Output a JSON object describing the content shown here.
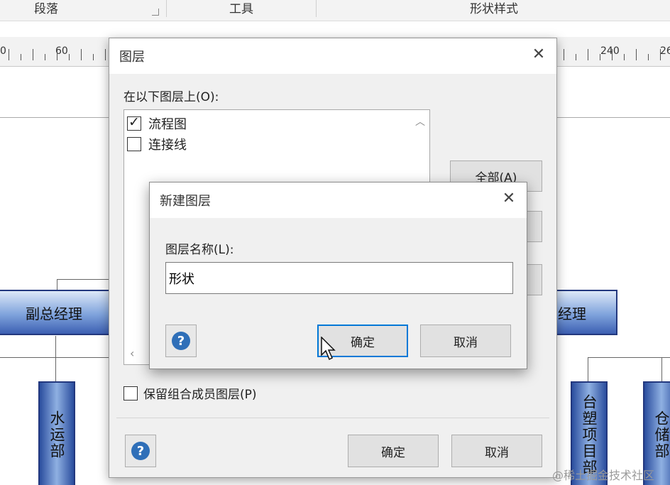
{
  "ribbon": {
    "paragraph": "段落",
    "tools": "工具",
    "shape_style": "形状样式"
  },
  "ruler": {
    "labels": [
      "0",
      "60",
      "240",
      "26"
    ]
  },
  "canvas": {
    "deputy_left": "副总经理",
    "deputy_right": "经理",
    "dept_water": "水运部",
    "dept_platform": "台塑项目部",
    "dept_storage": "仓储部"
  },
  "layer_dialog": {
    "title": "图层",
    "close_icon": "✕",
    "on_layers_label": "在以下图层上(O):",
    "layers": [
      {
        "name": "流程图",
        "checked": true
      },
      {
        "name": "连接线",
        "checked": false
      }
    ],
    "all_button": "全部(A)",
    "keep_members_label": "保留组合成员图层(P)",
    "keep_members_checked": false,
    "help": "?",
    "ok": "确定",
    "cancel": "取消"
  },
  "new_layer_dialog": {
    "title": "新建图层",
    "close_icon": "✕",
    "name_label": "图层名称(L):",
    "name_value": "形状",
    "help": "?",
    "ok": "确定",
    "cancel": "取消"
  },
  "watermark": "@稀土掘金技术社区"
}
